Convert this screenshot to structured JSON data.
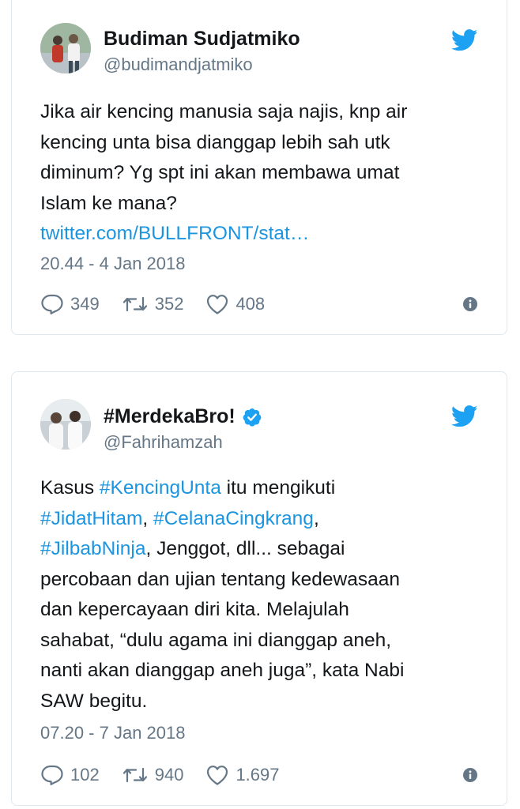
{
  "tweets": [
    {
      "author_name": "Budiman Sudjatmiko",
      "handle": "@budimandjatmiko",
      "verified": false,
      "text_lines": [
        "Jika air kencing manusia saja najis, knp air",
        "kencing unta bisa dianggap lebih sah utk",
        "diminum? Yg spt ini akan membawa umat",
        "Islam ke mana?"
      ],
      "link": "twitter.com/BULLFRONT/stat…",
      "timestamp": "20.44 - 4 Jan 2018",
      "replies": "349",
      "retweets": "352",
      "likes": "408"
    },
    {
      "author_name": "#MerdekaBro!",
      "handle": "@Fahrihamzah",
      "verified": true,
      "text": {
        "l1_a": "Kasus ",
        "l1_tag": "#KencingUnta",
        "l1_b": " itu mengikuti",
        "l2_tag1": "#JidatHitam",
        "l2_sep": ", ",
        "l2_tag2": "#CelanaCingkrang",
        "l2_b": ",",
        "l3_tag": "#JilbabNinja",
        "l3_b": ", Jenggot, dll... sebagai",
        "l4": "percobaan dan ujian tentang kedewasaan",
        "l5": "dan kepercayaan diri kita. Melajulah",
        "l6": "sahabat, “dulu agama ini dianggap aneh,",
        "l7": "nanti akan dianggap aneh juga”, kata Nabi",
        "l8": "SAW begitu."
      },
      "timestamp": "07.20 - 7 Jan 2018",
      "replies": "102",
      "retweets": "940",
      "likes": "1.697"
    }
  ],
  "icons": {
    "brand_bird": "twitter-bird-icon",
    "reply": "reply-icon",
    "retweet": "retweet-icon",
    "like": "heart-icon",
    "info": "info-icon",
    "verified": "verified-badge-icon"
  },
  "colors": {
    "brand_blue": "#1da1f2",
    "link_blue": "#1b95e0",
    "secondary_text": "#657786",
    "border": "#e1e8ed"
  }
}
